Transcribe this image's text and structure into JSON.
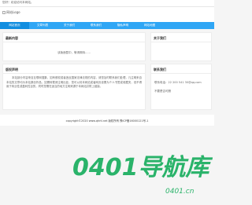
{
  "topbar": {
    "welcome": "您好！欢迎访问本网站。"
  },
  "header": {
    "logo_text": "网站Logo"
  },
  "nav": {
    "items": [
      {
        "label": "网站首页"
      },
      {
        "label": "文章列表"
      },
      {
        "label": "关于我们"
      },
      {
        "label": "联系我们"
      },
      {
        "label": "隐私声明"
      },
      {
        "label": "网站地图"
      }
    ]
  },
  "latest": {
    "title": "最新内容",
    "empty_text": "该版面暂中，敬请期待......"
  },
  "about_side": {
    "title": "关于我们"
  },
  "disclaimer": {
    "title": "版权声明",
    "paragraph": "本站部分内容来自互联网搜集，如有侵权或者违反国家法律法规的内容，请您及时联系我们处理，凡注明来自本站的文章均为本站原创作品，如需转载请注明出处，您可以将本网站或者网页设置为个人书签或收藏夹，但不得用于商业性或盈利性目的，同时您需在适当的地方注明来源于本网站并附上链接。"
  },
  "contact": {
    "title": "联系我们",
    "phone": "联系电话：22 200 541 30@qq.com",
    "qq": "不要是否可删"
  },
  "footer": {
    "copyright": "copyright©2020 www.qhrtl.net 版权所有    豫ICP备16000121号-1"
  },
  "watermark": {
    "text": "0401导航库",
    "url": "0401.cn"
  },
  "colors": {
    "nav": "#2fa6f5",
    "nav_active": "#118ee0",
    "watermark": "#2ab36a"
  }
}
